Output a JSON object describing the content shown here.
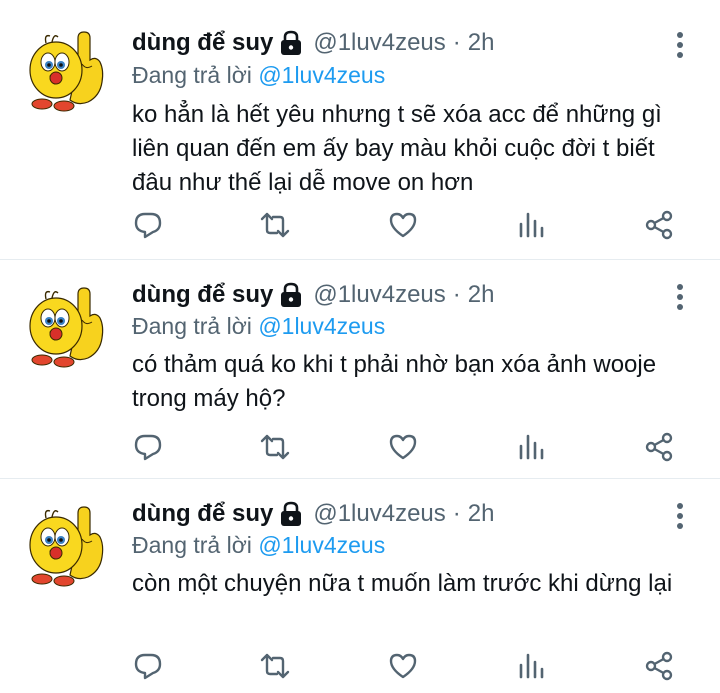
{
  "tweets": [
    {
      "name": "dùng để suy",
      "handle": "@1luv4zeus",
      "dot": "·",
      "time": "2h",
      "reply_prefix": "Đang trả lời",
      "reply_to": "@1luv4zeus",
      "text": "ko hẳn là hết yêu nhưng t sẽ xóa acc để những gì liên quan đến em ấy bay màu khỏi cuộc đời t biết đâu như thế lại dễ move on hơn"
    },
    {
      "name": "dùng để suy",
      "handle": "@1luv4zeus",
      "dot": "·",
      "time": "2h",
      "reply_prefix": "Đang trả lời",
      "reply_to": "@1luv4zeus",
      "text": "có thảm quá ko khi t phải nhờ bạn xóa ảnh wooje trong máy hộ?"
    },
    {
      "name": "dùng để suy",
      "handle": "@1luv4zeus",
      "dot": "·",
      "time": "2h",
      "reply_prefix": "Đang trả lời",
      "reply_to": "@1luv4zeus",
      "text": "còn một chuyện nữa t muốn làm trước khi dừng lại"
    }
  ],
  "icons": {
    "lock": "lock-icon",
    "more": "more-vertical-icon",
    "reply": "reply-icon",
    "retweet": "retweet-icon",
    "like": "heart-icon",
    "stats": "analytics-icon",
    "share": "share-icon"
  },
  "colors": {
    "text": "#0f1419",
    "secondary": "#536471",
    "link": "#1d9bf0",
    "divider": "#e6ecf0"
  }
}
